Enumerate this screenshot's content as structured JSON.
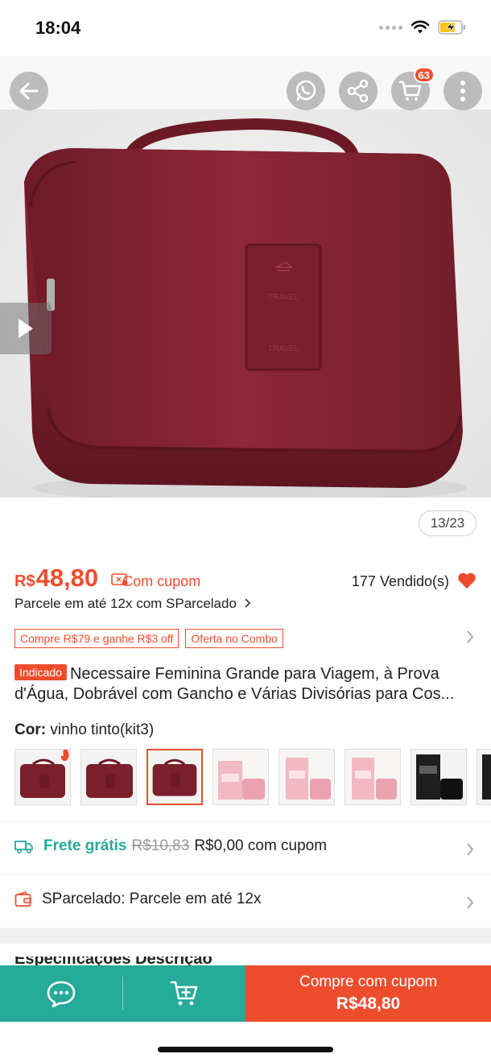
{
  "status": {
    "time": "18:04"
  },
  "header": {
    "cart_count": "63"
  },
  "gallery": {
    "counter": "13/23",
    "badge_text": "TRAVEL",
    "badge_text_bottom": "TRAVEL"
  },
  "price": {
    "currency": "R$",
    "value": "48,80",
    "coupon_label": "Com cupom",
    "sold": "177 Vendido(s)",
    "installments": "Parcele em até 12x com SParcelado"
  },
  "promotions": [
    "Compre R$79 e ganhe R$3 off",
    "Oferta no Combo"
  ],
  "product": {
    "badge": "Indicado",
    "title_line1": "Necessaire Feminina Grande para Viagem, à Prova",
    "title_line2": "d'Água, Dobrável com Gancho e Várias Divisórias para Cos..."
  },
  "variant": {
    "label": "Cor:",
    "value": "vinho tinto(kit3)"
  },
  "shipping": {
    "label": "Frete grátis",
    "old_price": "R$10,83",
    "new_price": "R$0,00 com cupom"
  },
  "sparcelado": {
    "label": "SParcelado: Parcele em até 12x"
  },
  "specs_peek": "Especificações   Descrição",
  "bottom_bar": {
    "buy_label": "Compre com cupom",
    "buy_price": "R$48,80"
  },
  "colors": {
    "accent": "#ee4d2d",
    "teal": "#26aa99",
    "bag": "#7a1f2b"
  },
  "icons": [
    "back-arrow-icon",
    "whatsapp-icon",
    "share-icon",
    "cart-icon",
    "more-icon",
    "play-icon",
    "heart-icon",
    "coupon-icon",
    "truck-icon",
    "wallet-icon",
    "chat-icon",
    "add-to-cart-icon",
    "chevron-right-icon"
  ]
}
